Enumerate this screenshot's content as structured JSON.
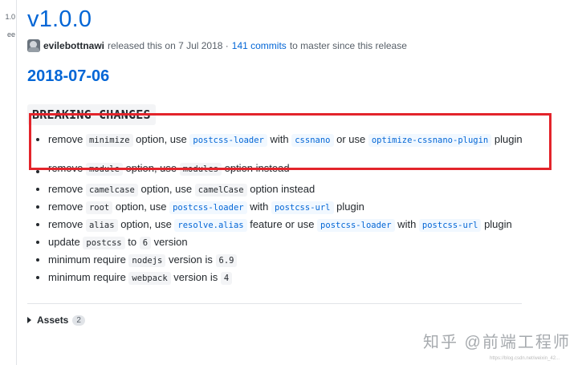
{
  "sidebar": {
    "fragments": [
      "1.0",
      "ee"
    ]
  },
  "release": {
    "title": "v1.0.0",
    "author": "evilebottnawi",
    "released_text": "released this on 7 Jul 2018 ·",
    "commits_link": "141 commits",
    "commits_suffix": "to master since this release"
  },
  "date_heading": "2018-07-06",
  "section_heading": "BREAKING CHANGES",
  "changes": [
    {
      "parts": [
        {
          "t": "text",
          "v": "remove "
        },
        {
          "t": "code",
          "v": "minimize"
        },
        {
          "t": "text",
          "v": " option, use "
        },
        {
          "t": "codelink",
          "v": "postcss-loader"
        },
        {
          "t": "text",
          "v": " with "
        },
        {
          "t": "codelink",
          "v": "cssnano"
        },
        {
          "t": "text",
          "v": " or use "
        },
        {
          "t": "codelink",
          "v": "optimize-cssnano-plugin"
        },
        {
          "t": "text",
          "v": " plugin"
        }
      ]
    },
    {
      "parts": [
        {
          "t": "text",
          "v": "remove "
        },
        {
          "t": "code",
          "v": "module"
        },
        {
          "t": "text",
          "v": " option, use "
        },
        {
          "t": "code",
          "v": "modules"
        },
        {
          "t": "text",
          "v": " option instead"
        }
      ]
    },
    {
      "parts": [
        {
          "t": "text",
          "v": "remove "
        },
        {
          "t": "code",
          "v": "camelcase"
        },
        {
          "t": "text",
          "v": " option, use "
        },
        {
          "t": "code",
          "v": "camelCase"
        },
        {
          "t": "text",
          "v": " option instead"
        }
      ]
    },
    {
      "parts": [
        {
          "t": "text",
          "v": "remove "
        },
        {
          "t": "code",
          "v": "root"
        },
        {
          "t": "text",
          "v": " option, use "
        },
        {
          "t": "codelink",
          "v": "postcss-loader"
        },
        {
          "t": "text",
          "v": " with "
        },
        {
          "t": "codelink",
          "v": "postcss-url"
        },
        {
          "t": "text",
          "v": " plugin"
        }
      ]
    },
    {
      "parts": [
        {
          "t": "text",
          "v": "remove "
        },
        {
          "t": "code",
          "v": "alias"
        },
        {
          "t": "text",
          "v": " option, use "
        },
        {
          "t": "codelink",
          "v": "resolve.alias"
        },
        {
          "t": "text",
          "v": " feature or use "
        },
        {
          "t": "codelink",
          "v": "postcss-loader"
        },
        {
          "t": "text",
          "v": " with "
        },
        {
          "t": "codelink",
          "v": "postcss-url"
        },
        {
          "t": "text",
          "v": " plugin"
        }
      ]
    },
    {
      "parts": [
        {
          "t": "text",
          "v": "update "
        },
        {
          "t": "code",
          "v": "postcss"
        },
        {
          "t": "text",
          "v": " to "
        },
        {
          "t": "code",
          "v": "6"
        },
        {
          "t": "text",
          "v": " version"
        }
      ]
    },
    {
      "parts": [
        {
          "t": "text",
          "v": "minimum require "
        },
        {
          "t": "code",
          "v": "nodejs"
        },
        {
          "t": "text",
          "v": " version is "
        },
        {
          "t": "code",
          "v": "6.9"
        }
      ]
    },
    {
      "parts": [
        {
          "t": "text",
          "v": "minimum require "
        },
        {
          "t": "code",
          "v": "webpack"
        },
        {
          "t": "text",
          "v": " version is "
        },
        {
          "t": "code",
          "v": "4"
        }
      ]
    }
  ],
  "assets": {
    "label": "Assets",
    "count": "2"
  },
  "watermark": {
    "text": "知乎 @前端工程师",
    "url": "https://blog.csdn.net/weixin_42..."
  },
  "colors": {
    "link": "#0366d6",
    "highlight_box": "#e3242b",
    "text": "#24292e",
    "muted": "#586069"
  }
}
